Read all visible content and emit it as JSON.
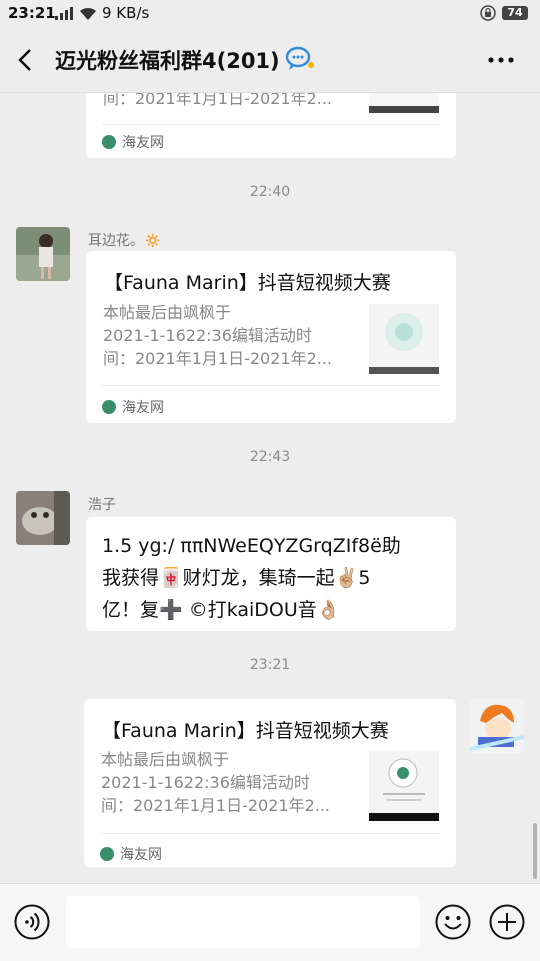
{
  "status_bar": {
    "time": "23:21",
    "speed": "9 KB/s",
    "battery": "74"
  },
  "chat_title": "迈光粉丝福利群4(201)",
  "messages": {
    "card0": {
      "partial_line": "间：2021年1月1日-2021年2...",
      "source": "海友网"
    },
    "time1": "22:40",
    "card1": {
      "sender": "耳边花。🔅",
      "title": "【Fauna Marin】抖音短视频大赛",
      "desc": [
        "本帖最后由飒枫于",
        "2021-1-1622:36编辑活动时",
        "间：2021年1月1日-2021年2..."
      ],
      "source": "海友网"
    },
    "time2": "22:43",
    "text1": {
      "sender": "浩子",
      "lines": [
        "1.5 yg:/ ππNWeEQYZGrqZIf8ë助",
        "我获得🀄财灯龙，集琦一起✌🏼5",
        "亿！复➕ ©打kaiDOU音👌🏼"
      ]
    },
    "time3": "23:21",
    "card2": {
      "title": "【Fauna Marin】抖音短视频大赛",
      "desc": [
        "本帖最后由飒枫于",
        "2021-1-1622:36编辑活动时",
        "间：2021年1月1日-2021年2..."
      ],
      "source": "海友网"
    }
  },
  "icons": [
    "back-icon",
    "group-chat-icon",
    "more-icon",
    "voice-icon",
    "emoji-icon",
    "plus-icon"
  ]
}
